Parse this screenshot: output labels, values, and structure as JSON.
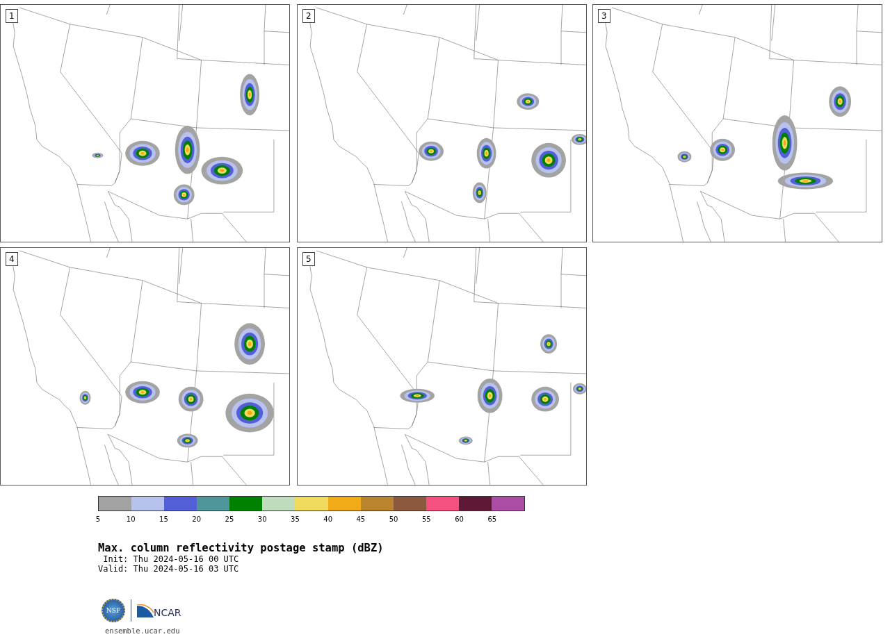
{
  "panels": [
    {
      "label": "1"
    },
    {
      "label": "2"
    },
    {
      "label": "3"
    },
    {
      "label": "4"
    },
    {
      "label": "5"
    }
  ],
  "colorbar": {
    "bins": [
      {
        "color": "#a3a3a3",
        "tick": "5"
      },
      {
        "color": "#b8c2ee",
        "tick": "10"
      },
      {
        "color": "#525fd6",
        "tick": "15"
      },
      {
        "color": "#4f969b",
        "tick": "20"
      },
      {
        "color": "#008000",
        "tick": "25"
      },
      {
        "color": "#bfdcbd",
        "tick": "30"
      },
      {
        "color": "#f0db5e",
        "tick": "35"
      },
      {
        "color": "#f0ab16",
        "tick": "40"
      },
      {
        "color": "#bb8530",
        "tick": "45"
      },
      {
        "color": "#8b5a3e",
        "tick": "50"
      },
      {
        "color": "#f5507f",
        "tick": "55"
      },
      {
        "color": "#601837",
        "tick": "60"
      },
      {
        "color": "#ac4da5",
        "tick": "65"
      }
    ]
  },
  "title": "Max. column reflectivity postage stamp (dBZ)",
  "init": " Init: Thu 2024-05-16 00 UTC",
  "valid": "Valid: Thu 2024-05-16 03 UTC",
  "logos": {
    "nsf": "NSF",
    "ncar": "NCAR"
  },
  "url": "ensemble.ucar.edu"
}
